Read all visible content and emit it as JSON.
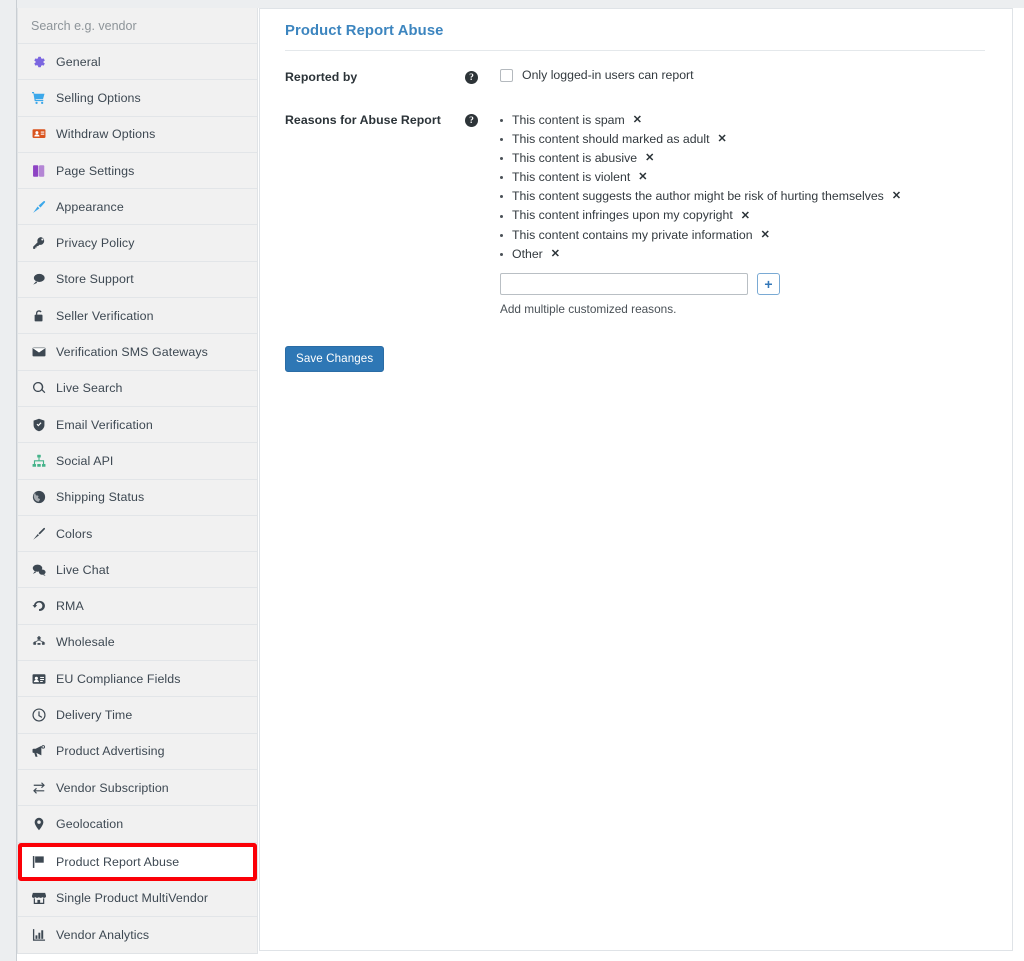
{
  "sidebar": {
    "search": {
      "placeholder": "Search e.g. vendor",
      "value": ""
    },
    "items": [
      {
        "label": "General",
        "icon": "gear-icon",
        "color": "#7b66e0"
      },
      {
        "label": "Selling Options",
        "icon": "shopping-cart-icon",
        "color": "#3ca8ea"
      },
      {
        "label": "Withdraw Options",
        "icon": "withdraw-card-icon",
        "color": "#d9531e"
      },
      {
        "label": "Page Settings",
        "icon": "book-pages-icon",
        "color": "#8e44c4"
      },
      {
        "label": "Appearance",
        "icon": "paint-brush-icon",
        "color": "#3ca8ea"
      },
      {
        "label": "Privacy Policy",
        "icon": "key-icon",
        "color": "#3d4852"
      },
      {
        "label": "Store Support",
        "icon": "speech-bubble-icon",
        "color": "#3d4852"
      },
      {
        "label": "Seller Verification",
        "icon": "lock-icon",
        "color": "#3d4852"
      },
      {
        "label": "Verification SMS Gateways",
        "icon": "envelope-icon",
        "color": "#3d4852"
      },
      {
        "label": "Live Search",
        "icon": "search-icon",
        "color": "#3d4852"
      },
      {
        "label": "Email Verification",
        "icon": "shield-icon",
        "color": "#3d4852"
      },
      {
        "label": "Social API",
        "icon": "sitemap-icon",
        "color": "#45b38a"
      },
      {
        "label": "Shipping Status",
        "icon": "globe-icon",
        "color": "#3d4852"
      },
      {
        "label": "Colors",
        "icon": "brush-icon",
        "color": "#3d4852"
      },
      {
        "label": "Live Chat",
        "icon": "chat-icon",
        "color": "#3d4852"
      },
      {
        "label": "RMA",
        "icon": "undo-arrow-icon",
        "color": "#3d4852"
      },
      {
        "label": "Wholesale",
        "icon": "network-icon",
        "color": "#3d4852"
      },
      {
        "label": "EU Compliance Fields",
        "icon": "id-card-icon",
        "color": "#3d4852"
      },
      {
        "label": "Delivery Time",
        "icon": "clock-icon",
        "color": "#3d4852"
      },
      {
        "label": "Product Advertising",
        "icon": "megaphone-icon",
        "color": "#3d4852"
      },
      {
        "label": "Vendor Subscription",
        "icon": "refresh-sync-icon",
        "color": "#3d4852"
      },
      {
        "label": "Geolocation",
        "icon": "map-pin-icon",
        "color": "#3d4852"
      },
      {
        "label": "Product Report Abuse",
        "icon": "flag-icon",
        "color": "#3d4852",
        "highlighted": true
      },
      {
        "label": "Single Product MultiVendor",
        "icon": "store-icon",
        "color": "#3d4852"
      },
      {
        "label": "Vendor Analytics",
        "icon": "bar-chart-icon",
        "color": "#3d4852"
      }
    ]
  },
  "main": {
    "title": "Product Report Abuse",
    "reported_by": {
      "label": "Reported by",
      "help": "?",
      "checkbox_label": "Only logged-in users can report",
      "checked": false
    },
    "reasons_section": {
      "label": "Reasons for Abuse Report",
      "help": "?",
      "remove_glyph": "✕",
      "items": [
        "This content is spam",
        "This content should marked as adult",
        "This content is abusive",
        "This content is violent",
        "This content suggests the author might be risk of hurting themselves",
        "This content infringes upon my copyright",
        "This content contains my private information",
        "Other"
      ],
      "new_reason_value": "",
      "new_reason_placeholder": "",
      "add_button_label": "+",
      "hint": "Add multiple customized reasons."
    },
    "save_label": "Save Changes"
  },
  "colors": {
    "accent_title": "#3c85bf",
    "save_button": "#2e77b5",
    "highlight_outline": "#fb0007",
    "sidebar_bg": "#f1f1f1"
  }
}
